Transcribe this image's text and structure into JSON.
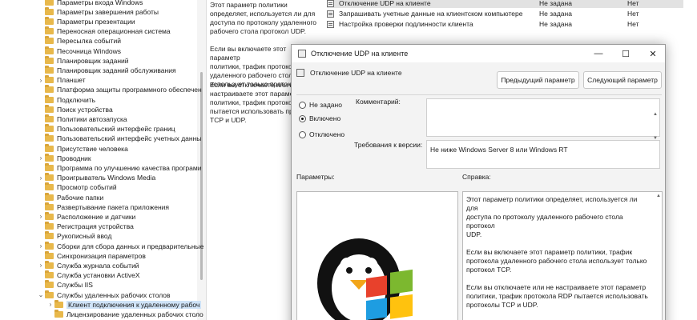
{
  "tree": {
    "items": [
      {
        "label": "Параметры входа Windows",
        "chevron": false
      },
      {
        "label": "Параметры завершения работы",
        "chevron": false
      },
      {
        "label": "Параметры презентации",
        "chevron": false
      },
      {
        "label": "Переносная операционная система",
        "chevron": false
      },
      {
        "label": "Пересылка событий",
        "chevron": false
      },
      {
        "label": "Песочница Windows",
        "chevron": false
      },
      {
        "label": "Планировщик заданий",
        "chevron": false
      },
      {
        "label": "Планировщик заданий обслуживания",
        "chevron": false
      },
      {
        "label": "Планшет",
        "chevron": true
      },
      {
        "label": "Платформа защиты программного обеспечен",
        "chevron": false
      },
      {
        "label": "Подключить",
        "chevron": false
      },
      {
        "label": "Поиск устройства",
        "chevron": false
      },
      {
        "label": "Политики автозапуска",
        "chevron": false
      },
      {
        "label": "Пользовательский интерфейс границ",
        "chevron": false
      },
      {
        "label": "Пользовательский интерфейс учетных данны",
        "chevron": false
      },
      {
        "label": "Присутствие человека",
        "chevron": false
      },
      {
        "label": "Проводник",
        "chevron": true
      },
      {
        "label": "Программа по улучшению качества програми",
        "chevron": false
      },
      {
        "label": "Проигрыватель Windows Media",
        "chevron": true
      },
      {
        "label": "Просмотр событий",
        "chevron": false
      },
      {
        "label": "Рабочие папки",
        "chevron": false
      },
      {
        "label": "Развертывание пакета приложения",
        "chevron": false
      },
      {
        "label": "Расположение и датчики",
        "chevron": true
      },
      {
        "label": "Регистрация устройства",
        "chevron": false
      },
      {
        "label": "Рукописный ввод",
        "chevron": false
      },
      {
        "label": "Сборки для сбора данных и предварительные",
        "chevron": true
      },
      {
        "label": "Синхронизация параметров",
        "chevron": false
      },
      {
        "label": "Служба журнала событий",
        "chevron": true
      },
      {
        "label": "Служба установки ActiveX",
        "chevron": false
      },
      {
        "label": "Службы IIS",
        "chevron": false
      },
      {
        "label": "Службы удаленных рабочих столов",
        "chevron": "down"
      },
      {
        "label": "Клиент подключения к удаленному рабоч",
        "chevron": true,
        "indent": true,
        "selected": true
      },
      {
        "label": "Лицензирование удаленных рабочих столо",
        "chevron": false,
        "indent": true
      }
    ]
  },
  "description": {
    "para1": "Этот параметр политики\nопределяет, используется ли для\nдоступа по протоколу удаленного\nрабочего стола протокол UDP.",
    "para2": "Если вы включаете этот параметр\nполитики, трафик протокола\nудаленного рабочего стола\nиспользует только протокол",
    "para3": "Если вы отключаете или не\nнастраиваете этот параметр\nполитики, трафик протокола\nпытается использовать прот\nTCP и UDP."
  },
  "settings_list": [
    {
      "name": "Отключение UDP на клиенте",
      "state": "Не задана",
      "comment": "Нет",
      "selected": true
    },
    {
      "name": "Запрашивать учетные данные на клиентском компьютере",
      "state": "Не задана",
      "comment": "Нет",
      "selected": false
    },
    {
      "name": "Настройка проверки подлинности клиента",
      "state": "Не задана",
      "comment": "Нет",
      "selected": false
    }
  ],
  "dialog": {
    "title": "Отключение UDP на клиенте",
    "header": "Отключение UDP на клиенте",
    "prev_button": "Предыдущий параметр",
    "next_button": "Следующий параметр",
    "radio_not_configured": "Не задано",
    "radio_enabled": "Включено",
    "radio_disabled": "Отключено",
    "selected_option": "enabled",
    "comment_label": "Комментарий:",
    "comment_value": "",
    "supported_label": "Требования к версии:",
    "supported_value": "Не ниже Windows Server 8 или Windows RT",
    "options_label": "Параметры:",
    "help_label": "Справка:",
    "help_text": "Этот параметр политики определяет, используется ли для\nдоступа по протоколу удаленного рабочего стола протокол\nUDP.\n\nЕсли вы включаете этот параметр политики, трафик\nпротокола удаленного рабочего стола использует только\nпротокол TCP.\n\nЕсли вы отключаете или не настраиваете этот параметр\nполитики, трафик протокола RDP пытается использовать\nпротоколы TCP и UDP.",
    "window_controls": {
      "minimize": "—",
      "maximize": "☐",
      "close": "✕"
    }
  }
}
